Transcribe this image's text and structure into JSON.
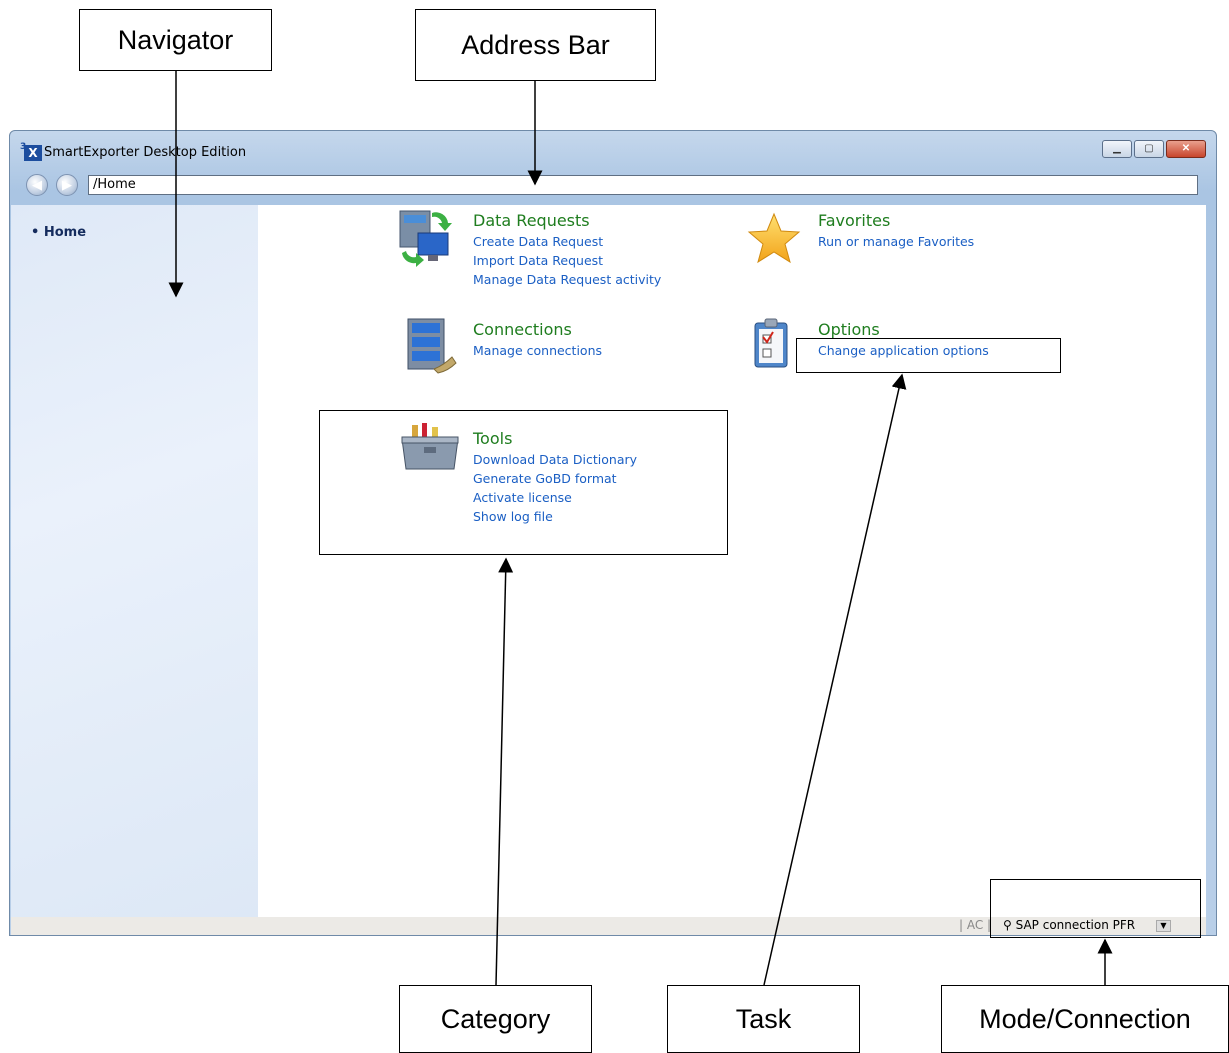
{
  "callouts": {
    "navigator": "Navigator",
    "address_bar": "Address Bar",
    "category": "Category",
    "task": "Task",
    "mode_connection": "Mode/Connection"
  },
  "window": {
    "title": "SmartExporter Desktop Edition",
    "icon_text": "X",
    "icon_superscript": "3"
  },
  "address": {
    "value": "/Home"
  },
  "navigator": {
    "items": [
      {
        "label": "Home"
      }
    ]
  },
  "categories": {
    "data_requests": {
      "title": "Data Requests",
      "tasks": [
        "Create Data Request",
        "Import Data Request",
        "Manage Data Request activity"
      ]
    },
    "favorites": {
      "title": "Favorites",
      "tasks": [
        "Run or manage Favorites"
      ]
    },
    "connections": {
      "title": "Connections",
      "tasks": [
        "Manage connections"
      ]
    },
    "options": {
      "title": "Options",
      "tasks": [
        "Change application options"
      ]
    },
    "tools": {
      "title": "Tools",
      "tasks": [
        "Download Data Dictionary",
        "Generate GoBD format",
        "Activate license",
        "Show log file"
      ]
    }
  },
  "statusbar": {
    "mode": "| AC |",
    "connection": "SAP connection PFR"
  },
  "colors": {
    "category_title": "#1f7d1f",
    "task_link": "#1b5fc4",
    "navigator_bg": "#dfe9f7"
  }
}
